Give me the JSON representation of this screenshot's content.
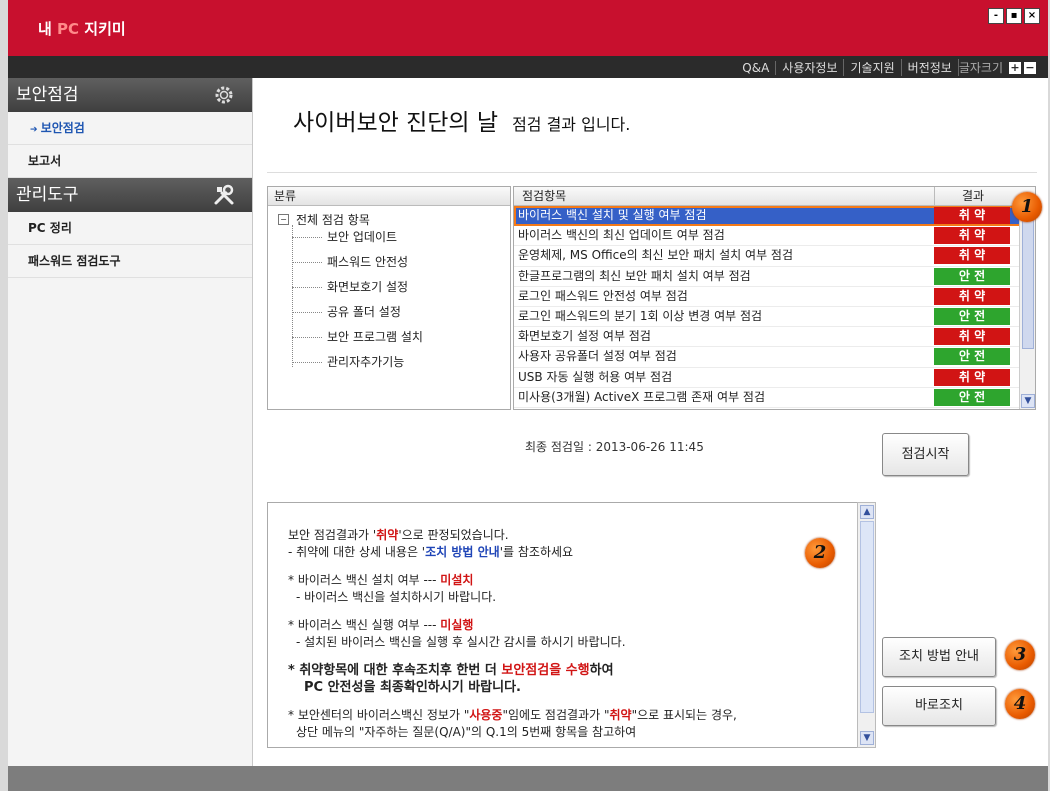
{
  "app": {
    "title_prefix": "내 ",
    "title_pc": "PC",
    "title_suffix": " 지키미",
    "window_buttons": [
      "-",
      "▪",
      "×"
    ]
  },
  "menu": {
    "items": [
      "Q&A",
      "사용자정보",
      "기술지원",
      "버전정보"
    ],
    "font_size_label": "글자크기",
    "font_plus": "+",
    "font_minus": "−"
  },
  "sidebar": {
    "section1": "보안점검",
    "section1_icon": "gear-icon",
    "items1": [
      "보안점검",
      "보고서"
    ],
    "section2": "관리도구",
    "section2_icon": "tools-icon",
    "items2": [
      "PC 정리",
      "패스워드 점검도구"
    ]
  },
  "main": {
    "title": "사이버보안 진단의 날",
    "subtitle": "점검 결과 입니다."
  },
  "tree": {
    "header": "분류",
    "root": "전체 점검 항목",
    "children": [
      "보안 업데이트",
      "패스워드 안전성",
      "화면보호기 설정",
      "공유 폴더 설정",
      "보안 프로그램 설치",
      "관리자추가기능"
    ]
  },
  "grid": {
    "header_item": "점검항목",
    "header_result": "결과",
    "rows": [
      {
        "name": "바이러스 백신 설치 및 실행 여부 점검",
        "result": "취 약",
        "status": "bad"
      },
      {
        "name": "바이러스 백신의 최신 업데이트 여부 점검",
        "result": "취 약",
        "status": "bad"
      },
      {
        "name": "운영체제, MS Office의 최신 보안 패치 설치 여부 점검",
        "result": "취 약",
        "status": "bad"
      },
      {
        "name": "한글프로그램의 최신 보안 패치 설치 여부 점검",
        "result": "안 전",
        "status": "good"
      },
      {
        "name": "로그인 패스워드 안전성 여부 점검",
        "result": "취 약",
        "status": "bad"
      },
      {
        "name": "로그인 패스워드의 분기 1회 이상 변경 여부 점검",
        "result": "안 전",
        "status": "good"
      },
      {
        "name": "화면보호기 설정 여부 점검",
        "result": "취 약",
        "status": "bad"
      },
      {
        "name": "사용자 공유폴더 설정 여부 점검",
        "result": "안 전",
        "status": "good"
      },
      {
        "name": "USB 자동 실행 허용 여부 점검",
        "result": "취 약",
        "status": "bad"
      },
      {
        "name": "미사용(3개월) ActiveX 프로그램 존재 여부 점검",
        "result": "안 전",
        "status": "good"
      }
    ]
  },
  "last_check": {
    "label": "최종 점검일 : ",
    "value": "2013-06-26 11:45"
  },
  "buttons": {
    "start": "점검시작",
    "guide": "조치 방법 안내",
    "fix": "바로조치"
  },
  "message": {
    "l1a": "보안 점검결과가 '",
    "l1b": "취약",
    "l1c": "'으로 판정되었습니다.",
    "l2a": "- 취약에 대한 상세 내용은 '",
    "l2b": "조치 방법 안내",
    "l2c": "'를 참조하세요",
    "l3a": "* 바이러스 백신 설치 여부 --- ",
    "l3b": "미설치",
    "l4": "- 바이러스 백신을 설치하시기 바랍니다.",
    "l5a": "* 바이러스 백신 실행 여부 --- ",
    "l5b": "미실행",
    "l6": "- 설치된 바이러스 백신을 실행 후 실시간 감시를 하시기 바랍니다.",
    "l7a": "* 취약항목에 대한 후속조치후 한번 더 ",
    "l7b": "보안점검을 수행",
    "l7c": "하여",
    "l8": "PC 안전성을 최종확인하시기 바랍니다.",
    "l9a": "* 보안센터의 바이러스백신 정보가 \"",
    "l9b": "사용중",
    "l9c": "\"임에도 점검결과가 \"",
    "l9d": "취약",
    "l9e": "\"으로 표시되는 경우,",
    "l10": "상단 메뉴의 \"자주하는 질문(Q/A)\"의 Q.1의 5번째 항목을 참고하여"
  },
  "markers": [
    "1",
    "2",
    "3",
    "4"
  ],
  "colors": {
    "brand_red": "#c8102e",
    "danger": "#d11414",
    "safe": "#2ea52e",
    "selection": "#3560c7",
    "marker_orange": "#e85a00"
  }
}
